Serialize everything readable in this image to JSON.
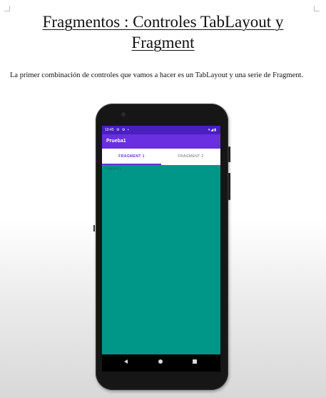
{
  "document": {
    "title_line1": "Fragmentos : Controles TabLayout y",
    "title_line2": "Fragment",
    "intro": "La primer combinación de controles que vamos a hacer es un TabLayout y una serie de Fragment."
  },
  "phone": {
    "status_time": "10:45",
    "status_left_icons": "⚙ ⚙ ▪",
    "status_right_icons": "▾◢▮",
    "app_title": "Prueba1",
    "tabs": [
      {
        "label": "FRAGMENT 1",
        "selected": true
      },
      {
        "label": "FRAGMENT 2",
        "selected": false
      }
    ],
    "fragment_content": "Fragment 1",
    "colors": {
      "status_bar": "#4a1fbf",
      "app_bar": "#6a2fe0",
      "accent": "#6a2fe0",
      "content_background": "#009688"
    },
    "nav_icons": [
      "back-icon",
      "home-icon",
      "recents-icon"
    ]
  }
}
